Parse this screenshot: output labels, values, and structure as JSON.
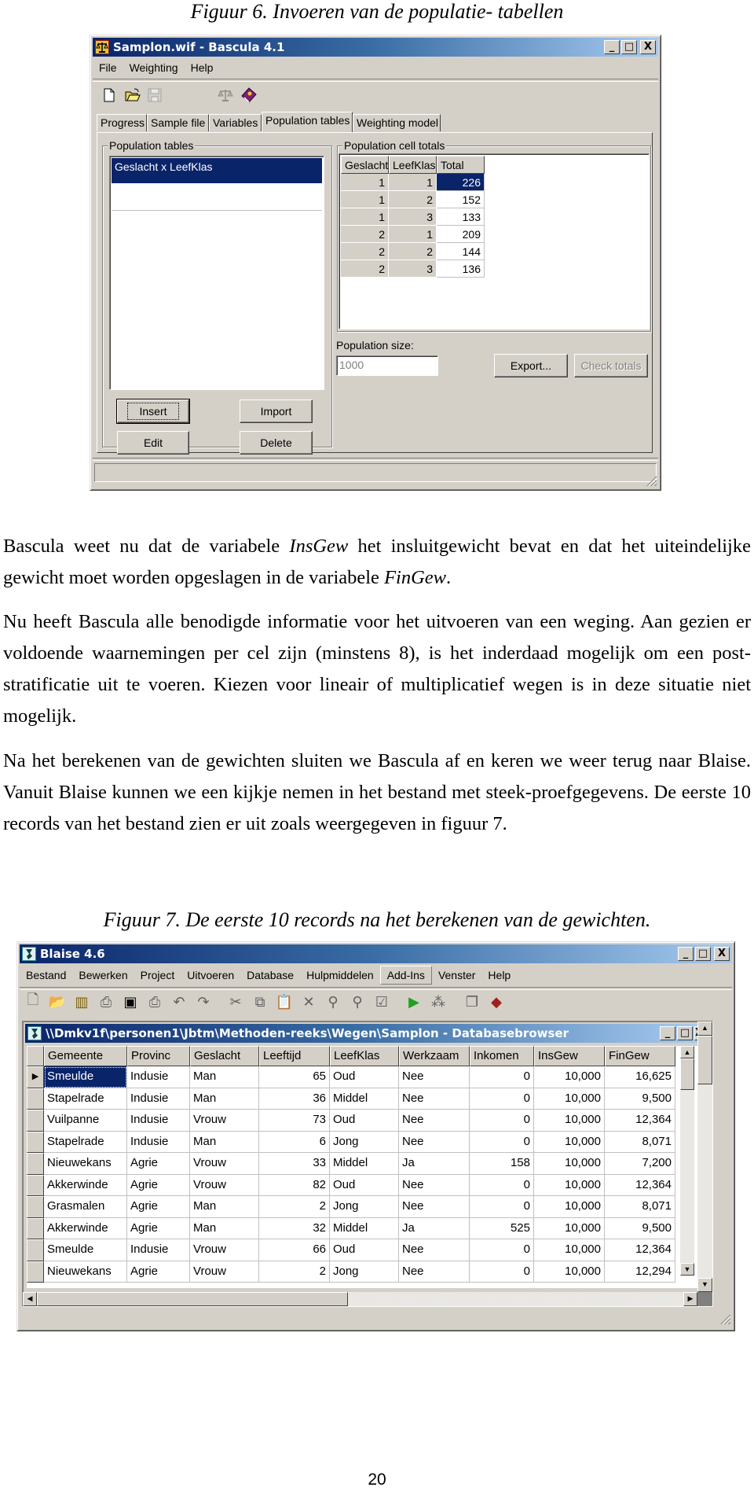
{
  "figure6": {
    "caption": "Figuur 6. Invoeren van de populatie- tabellen",
    "window": {
      "title": "Samplon.wif - Bascula 4.1",
      "app_icon": "scales-icon",
      "title_buttons": {
        "minimize": "_",
        "maximize": "□",
        "close": "X"
      },
      "menu": [
        "File",
        "Weighting",
        "Help"
      ],
      "menu_accel": [
        "F",
        "W",
        "H"
      ],
      "toolbar": [
        "new-file-icon",
        "open-folder-icon",
        "save-disk-icon",
        "scales-icon",
        "help-book-icon"
      ],
      "tabs": [
        "Progress",
        "Sample file",
        "Variables",
        "Population tables",
        "Weighting model"
      ],
      "active_tab": "Population tables",
      "left_group": {
        "title": "Population tables",
        "items": [
          "Geslacht x LeefKlas"
        ],
        "selected": "Geslacht x LeefKlas",
        "buttons": {
          "insert": "Insert",
          "import": "Import",
          "edit": "Edit",
          "delete": "Delete"
        }
      },
      "right_group": {
        "title": "Population cell totals",
        "columns": [
          "Geslacht",
          "LeefKlas",
          "Total"
        ],
        "rows": [
          [
            "1",
            "1",
            "226"
          ],
          [
            "1",
            "2",
            "152"
          ],
          [
            "1",
            "3",
            "133"
          ],
          [
            "2",
            "1",
            "209"
          ],
          [
            "2",
            "2",
            "144"
          ],
          [
            "2",
            "3",
            "136"
          ]
        ],
        "selected_cell": "226"
      },
      "population_size_label": "Population size:",
      "population_size_value": "1000",
      "export_button": "Export...",
      "check_totals_button": "Check totals"
    }
  },
  "paragraphs": {
    "p1_pre": "Bascula weet nu dat de variabele ",
    "p1_em1": "InsGew",
    "p1_mid": " het insluitgewicht bevat en dat het uiteindelijke gewicht moet worden opgeslagen in de variabele ",
    "p1_em2": "FinGew",
    "p1_post": ".",
    "p2": "Nu heeft Bascula alle benodigde informatie voor het uitvoeren van een weging. Aan gezien er voldoende waarnemingen per cel zijn (minstens 8), is het inderdaad mogelijk om een post-stratificatie uit te voeren. Kiezen voor lineair of multiplicatief wegen is in deze situatie niet mogelijk.",
    "p3": "Na het berekenen van de gewichten sluiten we Bascula af en keren we weer terug naar Blaise. Vanuit Blaise kunnen we een kijkje nemen in het bestand met steek-proefgegevens. De eerste 10 records van het bestand zien er uit zoals weergegeven in figuur 7."
  },
  "figure7": {
    "caption": "Figuur 7. De eerste 10 records na het berekenen van de gewichten.",
    "window": {
      "title": "Blaise 4.6",
      "app_icon": "blaise-icon",
      "title_buttons": {
        "minimize": "_",
        "maximize": "□",
        "close": "X"
      },
      "menu": [
        "Bestand",
        "Bewerken",
        "Project",
        "Uitvoeren",
        "Database",
        "Hulpmiddelen",
        "Add-Ins",
        "Venster",
        "Help"
      ],
      "active_menu": "Add-Ins",
      "toolbar": [
        "new-file-icon",
        "open-folder-icon",
        "database-icon",
        "print-preview-icon",
        "save-disk-icon",
        "print-icon",
        "undo-icon",
        "redo-icon",
        "cut-icon",
        "copy-icon",
        "paste-icon",
        "delete-icon",
        "find-icon",
        "replace-icon",
        "check-icon",
        "run-icon",
        "structure-icon",
        "pages-icon",
        "help-book-icon"
      ],
      "child": {
        "title": "\\\\Dmkv1f\\personen1\\Jbtm\\Methoden-reeks\\Wegen\\Samplon - Databasebrowser",
        "columns": [
          "Gemeente",
          "Provinc",
          "Geslacht",
          "Leeftijd",
          "LeefKlas",
          "Werkzaam",
          "Inkomen",
          "InsGew",
          "FinGew"
        ],
        "rows": [
          [
            "Smeulde",
            "Indusie",
            "Man",
            "65",
            "Oud",
            "Nee",
            "0",
            "10,000",
            "16,625"
          ],
          [
            "Stapelrade",
            "Indusie",
            "Man",
            "36",
            "Middel",
            "Nee",
            "0",
            "10,000",
            "9,500"
          ],
          [
            "Vuilpanne",
            "Indusie",
            "Vrouw",
            "73",
            "Oud",
            "Nee",
            "0",
            "10,000",
            "12,364"
          ],
          [
            "Stapelrade",
            "Indusie",
            "Man",
            "6",
            "Jong",
            "Nee",
            "0",
            "10,000",
            "8,071"
          ],
          [
            "Nieuwekans",
            "Agrie",
            "Vrouw",
            "33",
            "Middel",
            "Ja",
            "158",
            "10,000",
            "7,200"
          ],
          [
            "Akkerwinde",
            "Agrie",
            "Vrouw",
            "82",
            "Oud",
            "Nee",
            "0",
            "10,000",
            "12,364"
          ],
          [
            "Grasmalen",
            "Agrie",
            "Man",
            "2",
            "Jong",
            "Nee",
            "0",
            "10,000",
            "8,071"
          ],
          [
            "Akkerwinde",
            "Agrie",
            "Man",
            "32",
            "Middel",
            "Ja",
            "525",
            "10,000",
            "9,500"
          ],
          [
            "Smeulde",
            "Indusie",
            "Vrouw",
            "66",
            "Oud",
            "Nee",
            "0",
            "10,000",
            "12,364"
          ],
          [
            "Nieuwekans",
            "Agrie",
            "Vrouw",
            "2",
            "Jong",
            "Nee",
            "0",
            "10,000",
            "12,294"
          ]
        ],
        "selected_cell": "Smeulde",
        "current_row_indicator": "▶"
      }
    }
  },
  "page_number": "20",
  "colors": {
    "titlebar_start": "#0a246a",
    "titlebar_end": "#a6caf0",
    "face": "#d4d0c8",
    "selection": "#0a246a"
  }
}
